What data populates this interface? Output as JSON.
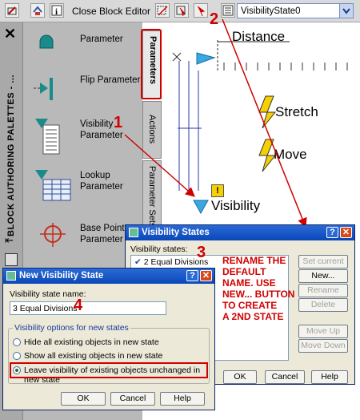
{
  "toolbar": {
    "close_label": "Close Block Editor",
    "visibility_state_value": "VisibilityState0"
  },
  "palette": {
    "title": "BLOCK AUTHORING PALETTES - ...",
    "tools": [
      {
        "label": "Parameter"
      },
      {
        "label": "Flip Parameter"
      },
      {
        "label": "Visibility Parameter"
      },
      {
        "label": "Lookup Parameter"
      },
      {
        "label": "Base Point Parameter"
      }
    ],
    "tabs": [
      "Parameters",
      "Actions",
      "Parameter Sets"
    ]
  },
  "drawing": {
    "distance_label": "Distance",
    "stretch_label": "Stretch",
    "move_label": "Move",
    "visibility_label": "Visibility",
    "warning_glyph": "!"
  },
  "visibility_states_dialog": {
    "title": "Visibility States",
    "list_label": "Visibility states:",
    "list_items": [
      "2 Equal Divisions"
    ],
    "buttons": {
      "set_current": "Set current",
      "new": "New...",
      "rename": "Rename",
      "delete": "Delete",
      "move_up": "Move Up",
      "move_down": "Move Down",
      "ok": "OK",
      "cancel": "Cancel",
      "help": "Help"
    }
  },
  "new_state_dialog": {
    "title": "New Visibility State",
    "name_label": "Visibility state name:",
    "name_value": "3 Equal Divisions",
    "group_label": "Visibility options for new states",
    "options": [
      "Hide all existing objects in new state",
      "Show all existing objects in new state",
      "Leave visibility of existing objects unchanged in new state"
    ],
    "selected_option": 2,
    "buttons": {
      "ok": "OK",
      "cancel": "Cancel",
      "help": "Help"
    }
  },
  "annotations": {
    "num1": "1",
    "num2": "2",
    "num3": "3",
    "num4": "4",
    "instruction_lines": [
      "RENAME THE",
      "DEFAULT",
      "NAME.  USE",
      "NEW... BUTTON",
      "TO CREATE",
      "A 2ND STATE"
    ]
  },
  "colors": {
    "callout_red": "#d00000",
    "xp_title_blue": "#0a48b8",
    "dialog_bg": "#ece9d8",
    "parameter_teal": "#1a8a8a"
  }
}
